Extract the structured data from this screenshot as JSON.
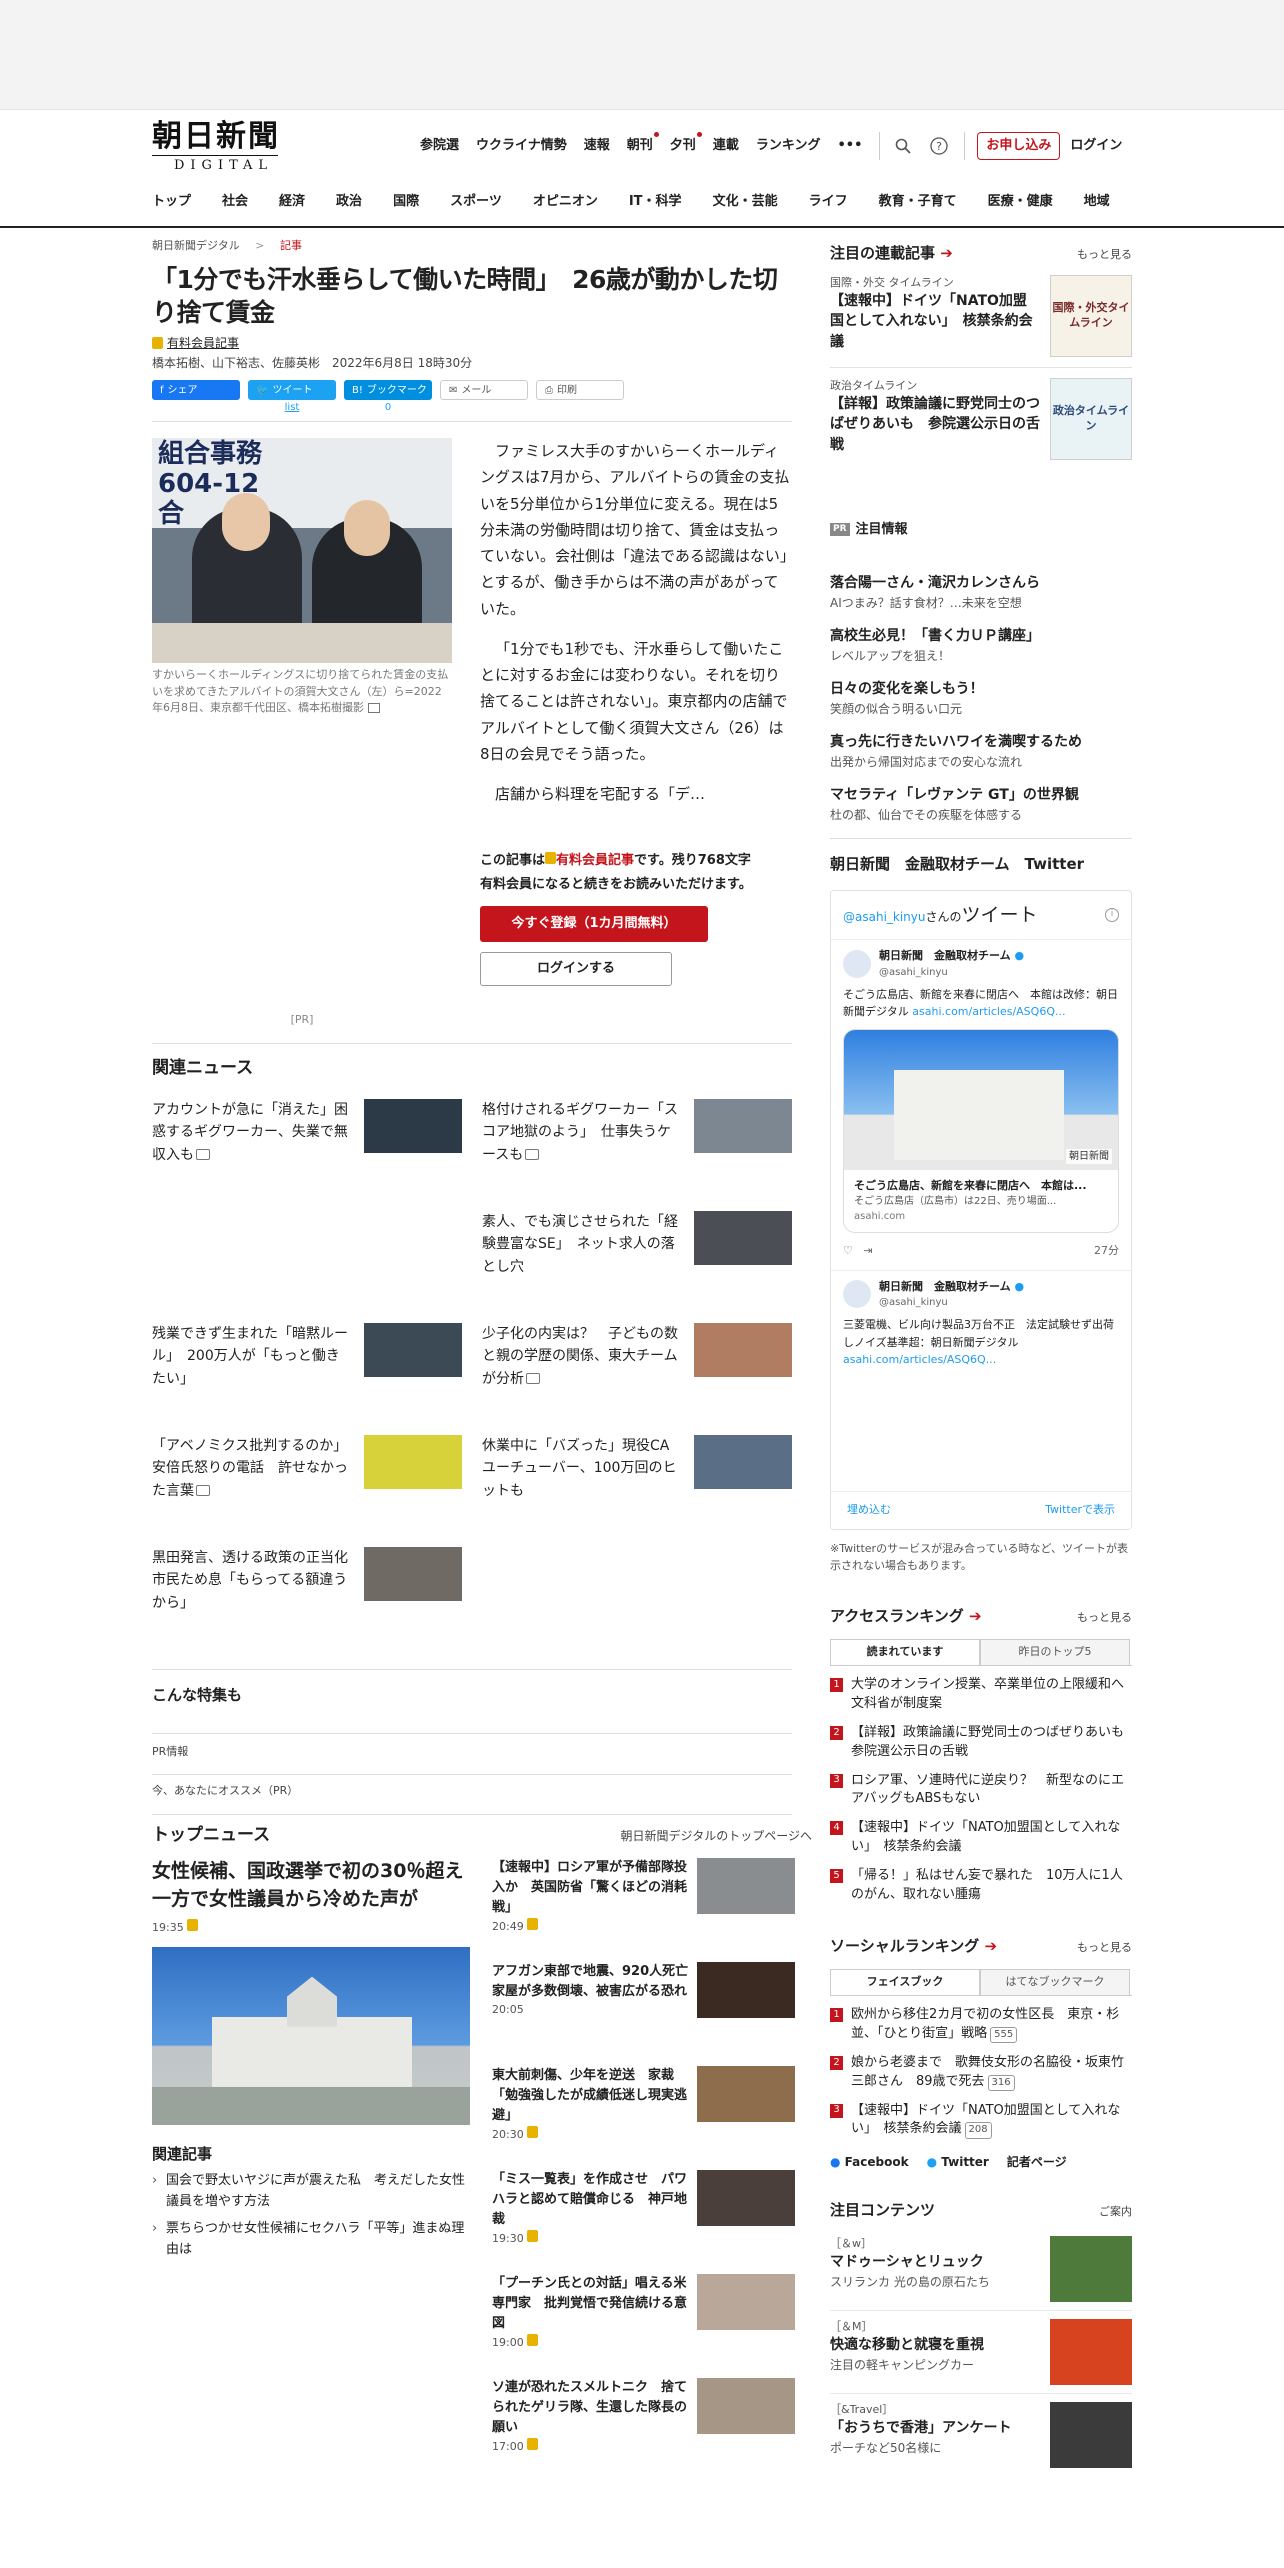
{
  "header": {
    "logo_jp": "朝日新聞",
    "logo_en": "DIGITAL",
    "subnav": [
      "参院選",
      "ウクライナ情勢",
      "速報",
      "朝刊",
      "夕刊",
      "連載",
      "ランキング"
    ],
    "more": "•••",
    "apply": "お申し込み",
    "login": "ログイン",
    "mainnav": [
      "トップ",
      "社会",
      "経済",
      "政治",
      "国際",
      "スポーツ",
      "オピニオン",
      "IT・科学",
      "文化・芸能",
      "ライフ",
      "教育・子育て",
      "医療・健康",
      "地域"
    ]
  },
  "article": {
    "breadcrumb_home": "朝日新聞デジタル",
    "breadcrumb_sep": ">",
    "breadcrumb_cur": "記事",
    "title": "「1分でも汗水垂らして働いた時間」　26歳が動かした切り捨て賃金",
    "paid_label": "有料会員記事",
    "byline": "橋本拓樹、山下裕志、佐藤英彬　2022年6月8日 18時30分",
    "share": {
      "facebook": "シェア",
      "twitter": "ツイート",
      "hatena": "ブックマーク",
      "mail": "メール",
      "print": "印刷",
      "twitter_count": "list",
      "hatena_count": "0"
    },
    "photo_sign": [
      "組合事務",
      "604-12",
      "合"
    ],
    "caption": "すかいらーくホールディングスに切り捨てられた賃金の支払いを求めてきたアルバイトの須賀大文さん（左）ら=2022年6月8日、東京都千代田区、橋本拓樹撮影",
    "paragraphs": [
      "ファミレス大手のすかいらーくホールディングスは7月から、アルバイトらの賃金の支払いを5分単位から1分単位に変える。現在は5分未満の労働時間は切り捨て、賃金は支払っていない。会社側は「違法である認識はない」とするが、働き手からは不満の声があがっていた。",
      "「1分でも1秒でも、汗水垂らして働いたことに対するお金には変わりない。それを切り捨てることは許されない」。東京都内の店舗でアルバイトとして働く須賀大文さん（26）は8日の会見でそう語った。",
      "店舗から料理を宅配する「デ…"
    ],
    "paywall_pre": "この記事は",
    "paywall_paid": "有料会員記事",
    "paywall_post": "です。残り768文字",
    "paywall_line2": "有料会員になると続きをお読みいただけます。",
    "register": "今すぐ登録（1カ月間無料）",
    "login_btn": "ログインする",
    "pr": "[PR]"
  },
  "related": {
    "heading": "関連ニュース",
    "items": [
      {
        "title": "アカウントが急に「消えた」困惑するギグワーカー、失業で無収入も",
        "comment": true
      },
      {
        "title": "格付けされるギグワーカー「スコア地獄のよう」　仕事失うケースも",
        "comment": true
      },
      {
        "title": "",
        "comment": false
      },
      {
        "title": "素人、でも演じさせられた「経験豊富なSE」　ネット求人の落とし穴",
        "comment": false
      },
      {
        "title": "残業できず生まれた「暗黙ルール」　200万人が「もっと働きたい」",
        "comment": false
      },
      {
        "title": "少子化の内実は？　子どもの数と親の学歴の関係、東大チームが分析",
        "comment": true
      },
      {
        "title": "「アベノミクス批判するのか」安倍氏怒りの電話　許せなかった言葉",
        "comment": true
      },
      {
        "title": "休業中に「バズった」現役CAユーチューバー、100万回のヒットも",
        "comment": false
      },
      {
        "title": "黒田発言、透ける政策の正当化　市民ため息「もらってる額違うから」",
        "comment": false
      }
    ]
  },
  "features": {
    "heading": "こんな特集も",
    "pr_info": "PR情報",
    "recommend": "今、あなたにオススメ（PR）"
  },
  "topnews": {
    "heading": "トップニュース",
    "link": "朝日新聞デジタルのトップページへ",
    "lead_title": "女性候補、国政選挙で初の30％超え　一方で女性議員から冷めた声が",
    "lead_time": "19:35",
    "related_heading": "関連記事",
    "related_items": [
      "国会で野太いヤジに声が震えた私　考えだした女性議員を増やす方法",
      "票ちらつかせ女性候補にセクハラ「平等」進まぬ理由は"
    ],
    "items": [
      {
        "title": "【速報中】ロシア軍が予備部隊投入か　英国防省「驚くほどの消耗戦」",
        "time": "20:49",
        "lock": true
      },
      {
        "title": "アフガン東部で地震、920人死亡　家屋が多数倒壊、被害広がる恐れ",
        "time": "20:05",
        "lock": false
      },
      {
        "title": "東大前刺傷、少年を逆送　家裁「勉強強したが成績低迷し現実逃避」",
        "time": "20:30",
        "lock": true
      },
      {
        "title": "「ミス一覧表」を作成させ　パワハラと認めて賠償命じる　神戸地裁",
        "time": "19:30",
        "lock": true
      },
      {
        "title": "「プーチン氏との対話」唱える米専門家　批判覚悟で発信続ける意図",
        "time": "19:00",
        "lock": true
      },
      {
        "title": "ソ連が恐れたスメルトニク　捨てられたゲリラ隊、生還した隊長の願い",
        "time": "17:00",
        "lock": true
      }
    ]
  },
  "sidebar": {
    "series_heading": "注目の連載記事",
    "more": "もっと見る",
    "series": [
      {
        "category": "国際・外交 タイムライン",
        "title": "【速報中】ドイツ「NATO加盟国として入れない」　核禁条約会議",
        "thumb": "国際・外交タイムライン"
      },
      {
        "category": "政治タイムライン",
        "title": "【詳報】政策論議に野党同士のつばぜりあいも　参院選公示日の舌戦",
        "thumb": "政治タイムライン"
      }
    ],
    "pr_badge": "PR",
    "info_heading": "注目情報",
    "info": [
      {
        "title": "落合陽一さん・滝沢カレンさんら",
        "sub": "AIつまみ？話す食材？…未来を空想"
      },
      {
        "title": "高校生必見！「書く力ＵＰ講座」",
        "sub": "レベルアップを狙え！"
      },
      {
        "title": "日々の変化を楽しもう！",
        "sub": "笑顔の似合う明るい口元"
      },
      {
        "title": "真っ先に行きたいハワイを満喫するため",
        "sub": "出発から帰国対応までの安心な流れ"
      },
      {
        "title": "マセラティ「レヴァンテ GT」の世界観",
        "sub": "杜の都、仙台でその疾駆を体感する"
      }
    ],
    "twitter": {
      "heading": "朝日新聞　金融取材チーム　Twitter",
      "tweets_by_user": "@asahi_kinyu",
      "tweets_by_suffix": "さんの",
      "tweets_label": "ツイート",
      "account_name": "朝日新聞　金融取材チーム",
      "handle": "@asahi_kinyu",
      "tweet1": "そごう広島店、新館を来春に閉店へ　本館は改修：朝日新聞デジタル",
      "tweet1_link": "asahi.com/articles/ASQ6Q...",
      "card_title": "そごう広島店、新館を来春に閉店へ　本館は...",
      "card_desc": "そごう広島店（広島市）は22日、売り場面...",
      "card_domain": "asahi.com",
      "card_logo": "朝日新聞",
      "time": "27分",
      "tweet2": "三菱電機、ビル向け製品3万台不正　法定試験せず出荷しノイズ基準超：朝日新聞デジタル",
      "tweet2_link": "asahi.com/articles/ASQ6Q...",
      "embed": "埋め込む",
      "view_on": "Twitterで表示",
      "note": "※Twitterのサービスが混み合っている時など、ツイートが表示されない場合もあります。"
    },
    "access": {
      "heading": "アクセスランキング",
      "tabs": [
        "読まれています",
        "昨日のトップ5"
      ],
      "items": [
        "大学のオンライン授業、卒業単位の上限緩和へ　文科省が制度案",
        "【詳報】政策論議に野党同士のつばぜりあいも　参院選公示日の舌戦",
        "ロシア軍、ソ連時代に逆戻り？　新型なのにエアバッグもABSもない",
        "【速報中】ドイツ「NATO加盟国として入れない」　核禁条約会議",
        "「帰る！」私はせん妄で暴れた　10万人に1人のがん、取れない腫瘍"
      ]
    },
    "social": {
      "heading": "ソーシャルランキング",
      "tabs": [
        "フェイスブック",
        "はてなブックマーク"
      ],
      "items": [
        {
          "title": "欧州から移住2カ月で初の女性区長　東京・杉並、「ひとり街宣」戦略",
          "count": "555"
        },
        {
          "title": "娘から老婆まで　歌舞伎女形の名脇役・坂東竹三郎さん　89歳で死去",
          "count": "316"
        },
        {
          "title": "【速報中】ドイツ「NATO加盟国として入れない」　核禁条約会議",
          "count": "208"
        }
      ],
      "links": [
        "Facebook",
        "Twitter",
        "記者ページ"
      ]
    },
    "picks": {
      "heading": "注目コンテンツ",
      "more": "ご案内",
      "items": [
        {
          "tag": "［＆w］",
          "title": "マドゥーシャとリュック",
          "sub": "スリランカ 光の島の原石たち"
        },
        {
          "tag": "［＆M］",
          "title": "快適な移動と就寝を重視",
          "sub": "注目の軽キャンピングカー"
        },
        {
          "tag": "［&Travel］",
          "title": "「おうちで香港」アンケート",
          "sub": "ポーチなど50名様に"
        }
      ]
    }
  }
}
